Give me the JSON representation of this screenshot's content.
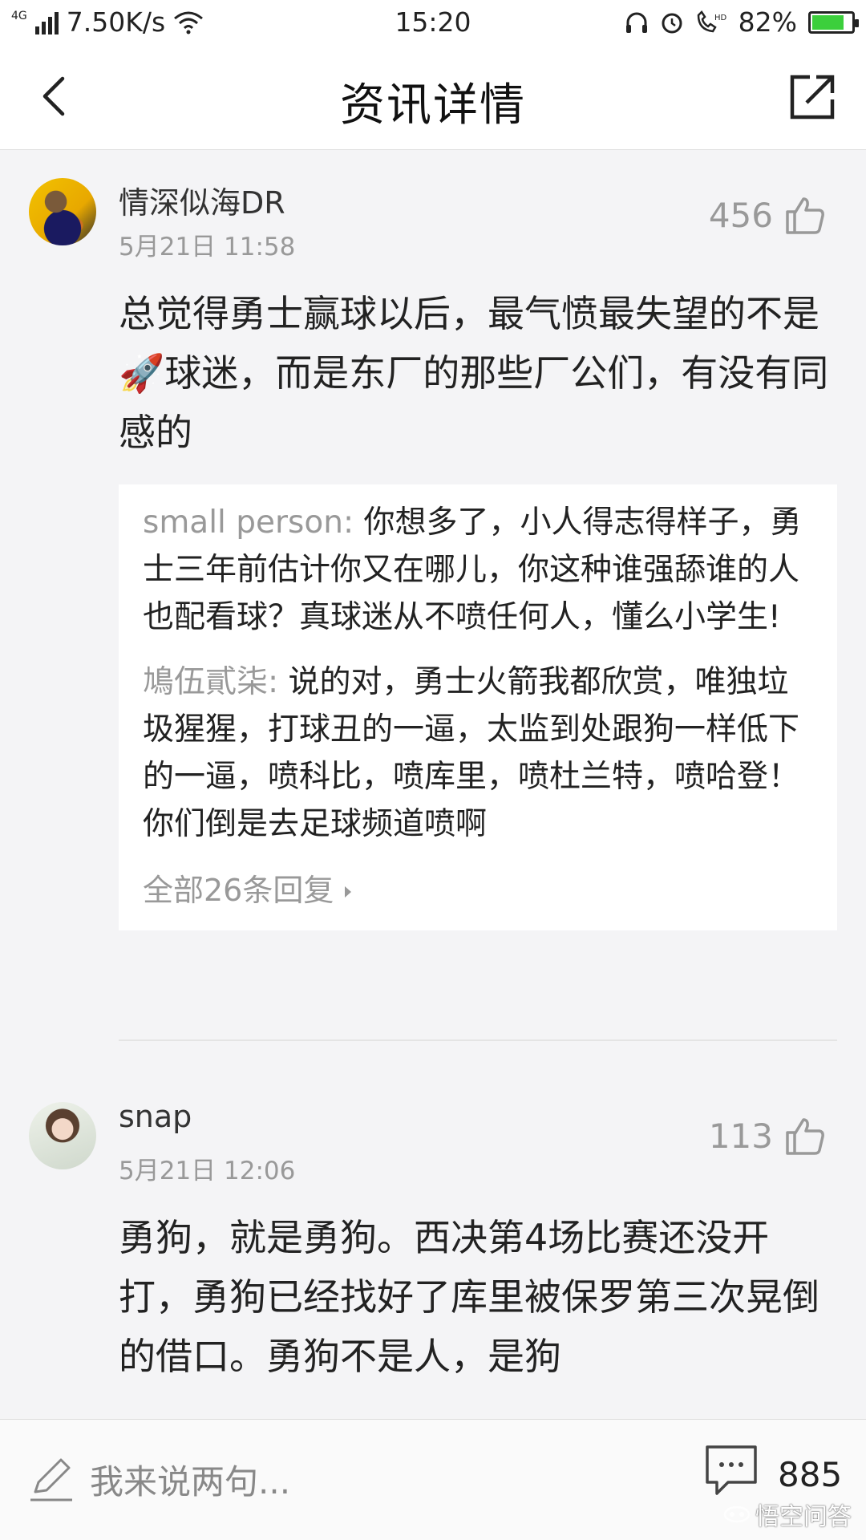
{
  "status_bar": {
    "network": "4G",
    "speed": "7.50K/s",
    "time": "15:20",
    "battery": "82%",
    "battery_level": 0.82
  },
  "nav": {
    "title": "资讯详情"
  },
  "comments": [
    {
      "username": "情深似海DR",
      "date": "5月21日 11:58",
      "likes": "456",
      "text_part1": "总觉得勇士赢球以后，最气愤最失望的不是",
      "rocket": "🚀",
      "text_part2": "球迷，而是东厂的那些厂公们，有没有同感的",
      "replies": [
        {
          "name": "small person:",
          "text": " 你想多了，小人得志得样子，勇士三年前估计你又在哪儿，你这种谁强舔谁的人也配看球？真球迷从不喷任何人，懂么小学生!"
        },
        {
          "name": "鳩伍貳柒:",
          "text": " 说的对，勇士火箭我都欣赏，唯独垃圾猩猩，打球丑的一逼，太监到处跟狗一样低下的一逼，喷科比，喷库里，喷杜兰特，喷哈登！你们倒是去足球频道喷啊"
        }
      ],
      "all_replies": "全部26条回复"
    },
    {
      "username": "snap",
      "date": "5月21日 12:06",
      "likes": "113",
      "text": "勇狗，就是勇狗。西决第4场比赛还没开打，勇狗已经找好了库里被保罗第三次晃倒的借口。勇狗不是人，是狗"
    }
  ],
  "bottom_bar": {
    "input_placeholder": "我来说两句...",
    "comment_count": "885"
  },
  "watermark": "悟空问答"
}
